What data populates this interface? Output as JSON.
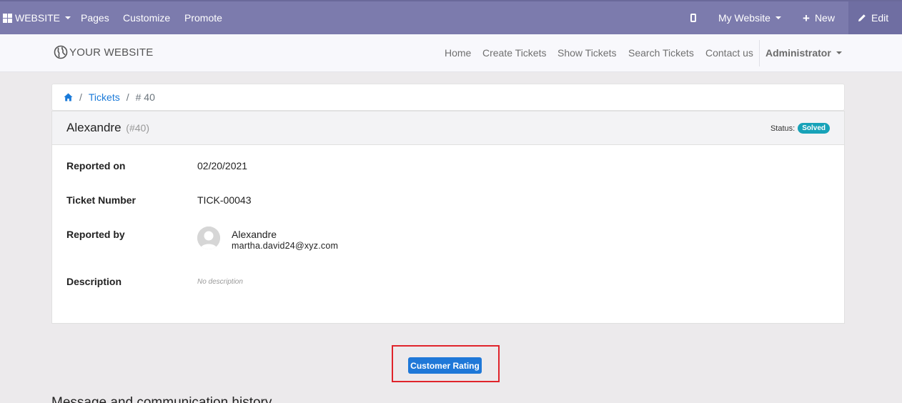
{
  "adminbar": {
    "website_label": "WEBSITE",
    "pages_label": "Pages",
    "customize_label": "Customize",
    "promote_label": "Promote",
    "mywebsite_label": "My Website",
    "new_label": "New",
    "edit_label": "Edit"
  },
  "header": {
    "logo_text": "YOUR WEBSITE",
    "menu": [
      "Home",
      "Create Tickets",
      "Show Tickets",
      "Search Tickets",
      "Contact us"
    ],
    "user_label": "Administrator"
  },
  "breadcrumb": {
    "tickets_label": "Tickets",
    "current": "# 40"
  },
  "ticket": {
    "title": "Alexandre",
    "id_text": "(#40)",
    "status_label": "Status:",
    "status_value": "Solved",
    "reported_on_label": "Reported on",
    "reported_on_value": "02/20/2021",
    "ticket_number_label": "Ticket Number",
    "ticket_number_value": "TICK-00043",
    "reported_by_label": "Reported by",
    "reporter_name": "Alexandre",
    "reporter_email": "martha.david24@xyz.com",
    "description_label": "Description",
    "description_value": "No description"
  },
  "rating_button_label": "Customer Rating",
  "history_title": "Message and communication history",
  "colors": {
    "adminbar_bg": "#7c7bad",
    "link": "#1a7ad9",
    "badge": "#17a2b8",
    "button": "#1f78d8",
    "highlight": "#e0242b"
  }
}
